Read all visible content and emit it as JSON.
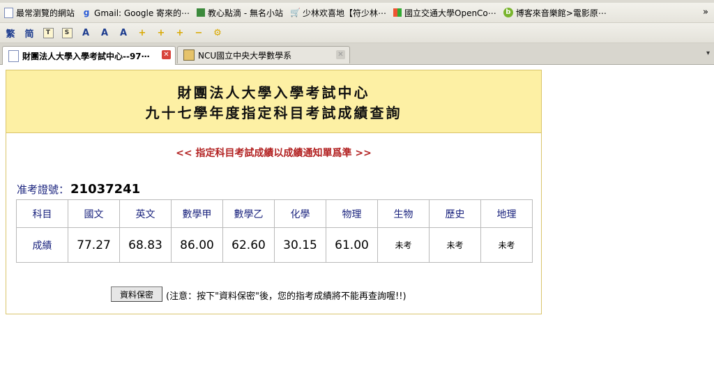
{
  "bookmarks": [
    {
      "icon": "page-icon",
      "label": "最常瀏覽的網站"
    },
    {
      "icon": "google-icon",
      "label": "Gmail: Google 寄來的⋯"
    },
    {
      "icon": "book-icon",
      "label": "教心點滴 - 無名小站"
    },
    {
      "icon": "cart-icon",
      "label": "少林欢喜地【符少林⋯"
    },
    {
      "icon": "grid-icon",
      "label": "國立交通大學OpenCo⋯"
    },
    {
      "icon": "b-icon",
      "label": "博客來音樂館>電影原⋯"
    }
  ],
  "bookmarks_more": "»",
  "toolbar": [
    "繁",
    "简",
    "T",
    "S",
    "A",
    "A",
    "A",
    "+",
    "+",
    "+",
    "−",
    "⚙"
  ],
  "tabs": [
    {
      "label": "財團法人大學入學考試中心--97⋯",
      "active": true
    },
    {
      "label": "NCU國立中央大學數學系",
      "active": false
    }
  ],
  "page": {
    "title_line1": "財團法人大學入學考試中心",
    "title_line2": "九十七學年度指定科目考試成績查詢",
    "notice": "<< 指定科目考試成績以成績通知單爲準 >>",
    "exam_no_label": "准考證號：",
    "exam_no": "21037241",
    "table": {
      "row_header_label": "科目",
      "row_score_label": "成績",
      "subjects": [
        "國文",
        "英文",
        "數學甲",
        "數學乙",
        "化學",
        "物理",
        "生物",
        "歷史",
        "地理"
      ],
      "scores": [
        "77.27",
        "68.83",
        "86.00",
        "62.60",
        "30.15",
        "61.00",
        "未考",
        "未考",
        "未考"
      ]
    },
    "save_button": "資料保密",
    "save_note": "(注意：按下\"資料保密\"後，您的指考成績將不能再查詢喔!!)"
  }
}
